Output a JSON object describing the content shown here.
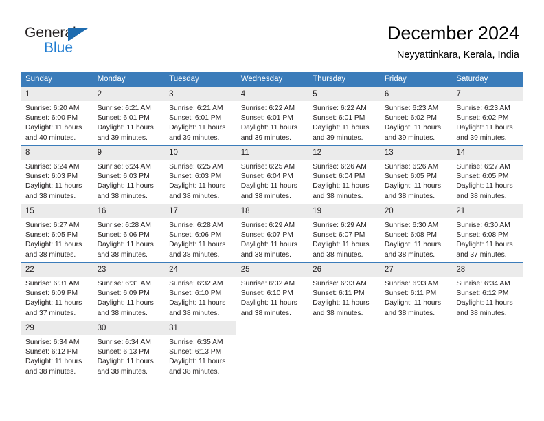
{
  "brand": {
    "name_top": "General",
    "name_bottom": "Blue"
  },
  "header": {
    "title": "December 2024",
    "subtitle": "Neyyattinkara, Kerala, India"
  },
  "colors": {
    "header_blue": "#3b7cba",
    "logo_blue": "#1e7bd0",
    "daynum_gray": "#ebebeb",
    "text": "#231f20"
  },
  "weekdays": [
    "Sunday",
    "Monday",
    "Tuesday",
    "Wednesday",
    "Thursday",
    "Friday",
    "Saturday"
  ],
  "weeks": [
    [
      {
        "day": "1",
        "sunrise": "Sunrise: 6:20 AM",
        "sunset": "Sunset: 6:00 PM",
        "daylight1": "Daylight: 11 hours",
        "daylight2": "and 40 minutes."
      },
      {
        "day": "2",
        "sunrise": "Sunrise: 6:21 AM",
        "sunset": "Sunset: 6:01 PM",
        "daylight1": "Daylight: 11 hours",
        "daylight2": "and 39 minutes."
      },
      {
        "day": "3",
        "sunrise": "Sunrise: 6:21 AM",
        "sunset": "Sunset: 6:01 PM",
        "daylight1": "Daylight: 11 hours",
        "daylight2": "and 39 minutes."
      },
      {
        "day": "4",
        "sunrise": "Sunrise: 6:22 AM",
        "sunset": "Sunset: 6:01 PM",
        "daylight1": "Daylight: 11 hours",
        "daylight2": "and 39 minutes."
      },
      {
        "day": "5",
        "sunrise": "Sunrise: 6:22 AM",
        "sunset": "Sunset: 6:01 PM",
        "daylight1": "Daylight: 11 hours",
        "daylight2": "and 39 minutes."
      },
      {
        "day": "6",
        "sunrise": "Sunrise: 6:23 AM",
        "sunset": "Sunset: 6:02 PM",
        "daylight1": "Daylight: 11 hours",
        "daylight2": "and 39 minutes."
      },
      {
        "day": "7",
        "sunrise": "Sunrise: 6:23 AM",
        "sunset": "Sunset: 6:02 PM",
        "daylight1": "Daylight: 11 hours",
        "daylight2": "and 39 minutes."
      }
    ],
    [
      {
        "day": "8",
        "sunrise": "Sunrise: 6:24 AM",
        "sunset": "Sunset: 6:03 PM",
        "daylight1": "Daylight: 11 hours",
        "daylight2": "and 38 minutes."
      },
      {
        "day": "9",
        "sunrise": "Sunrise: 6:24 AM",
        "sunset": "Sunset: 6:03 PM",
        "daylight1": "Daylight: 11 hours",
        "daylight2": "and 38 minutes."
      },
      {
        "day": "10",
        "sunrise": "Sunrise: 6:25 AM",
        "sunset": "Sunset: 6:03 PM",
        "daylight1": "Daylight: 11 hours",
        "daylight2": "and 38 minutes."
      },
      {
        "day": "11",
        "sunrise": "Sunrise: 6:25 AM",
        "sunset": "Sunset: 6:04 PM",
        "daylight1": "Daylight: 11 hours",
        "daylight2": "and 38 minutes."
      },
      {
        "day": "12",
        "sunrise": "Sunrise: 6:26 AM",
        "sunset": "Sunset: 6:04 PM",
        "daylight1": "Daylight: 11 hours",
        "daylight2": "and 38 minutes."
      },
      {
        "day": "13",
        "sunrise": "Sunrise: 6:26 AM",
        "sunset": "Sunset: 6:05 PM",
        "daylight1": "Daylight: 11 hours",
        "daylight2": "and 38 minutes."
      },
      {
        "day": "14",
        "sunrise": "Sunrise: 6:27 AM",
        "sunset": "Sunset: 6:05 PM",
        "daylight1": "Daylight: 11 hours",
        "daylight2": "and 38 minutes."
      }
    ],
    [
      {
        "day": "15",
        "sunrise": "Sunrise: 6:27 AM",
        "sunset": "Sunset: 6:05 PM",
        "daylight1": "Daylight: 11 hours",
        "daylight2": "and 38 minutes."
      },
      {
        "day": "16",
        "sunrise": "Sunrise: 6:28 AM",
        "sunset": "Sunset: 6:06 PM",
        "daylight1": "Daylight: 11 hours",
        "daylight2": "and 38 minutes."
      },
      {
        "day": "17",
        "sunrise": "Sunrise: 6:28 AM",
        "sunset": "Sunset: 6:06 PM",
        "daylight1": "Daylight: 11 hours",
        "daylight2": "and 38 minutes."
      },
      {
        "day": "18",
        "sunrise": "Sunrise: 6:29 AM",
        "sunset": "Sunset: 6:07 PM",
        "daylight1": "Daylight: 11 hours",
        "daylight2": "and 38 minutes."
      },
      {
        "day": "19",
        "sunrise": "Sunrise: 6:29 AM",
        "sunset": "Sunset: 6:07 PM",
        "daylight1": "Daylight: 11 hours",
        "daylight2": "and 38 minutes."
      },
      {
        "day": "20",
        "sunrise": "Sunrise: 6:30 AM",
        "sunset": "Sunset: 6:08 PM",
        "daylight1": "Daylight: 11 hours",
        "daylight2": "and 38 minutes."
      },
      {
        "day": "21",
        "sunrise": "Sunrise: 6:30 AM",
        "sunset": "Sunset: 6:08 PM",
        "daylight1": "Daylight: 11 hours",
        "daylight2": "and 37 minutes."
      }
    ],
    [
      {
        "day": "22",
        "sunrise": "Sunrise: 6:31 AM",
        "sunset": "Sunset: 6:09 PM",
        "daylight1": "Daylight: 11 hours",
        "daylight2": "and 37 minutes."
      },
      {
        "day": "23",
        "sunrise": "Sunrise: 6:31 AM",
        "sunset": "Sunset: 6:09 PM",
        "daylight1": "Daylight: 11 hours",
        "daylight2": "and 38 minutes."
      },
      {
        "day": "24",
        "sunrise": "Sunrise: 6:32 AM",
        "sunset": "Sunset: 6:10 PM",
        "daylight1": "Daylight: 11 hours",
        "daylight2": "and 38 minutes."
      },
      {
        "day": "25",
        "sunrise": "Sunrise: 6:32 AM",
        "sunset": "Sunset: 6:10 PM",
        "daylight1": "Daylight: 11 hours",
        "daylight2": "and 38 minutes."
      },
      {
        "day": "26",
        "sunrise": "Sunrise: 6:33 AM",
        "sunset": "Sunset: 6:11 PM",
        "daylight1": "Daylight: 11 hours",
        "daylight2": "and 38 minutes."
      },
      {
        "day": "27",
        "sunrise": "Sunrise: 6:33 AM",
        "sunset": "Sunset: 6:11 PM",
        "daylight1": "Daylight: 11 hours",
        "daylight2": "and 38 minutes."
      },
      {
        "day": "28",
        "sunrise": "Sunrise: 6:34 AM",
        "sunset": "Sunset: 6:12 PM",
        "daylight1": "Daylight: 11 hours",
        "daylight2": "and 38 minutes."
      }
    ],
    [
      {
        "day": "29",
        "sunrise": "Sunrise: 6:34 AM",
        "sunset": "Sunset: 6:12 PM",
        "daylight1": "Daylight: 11 hours",
        "daylight2": "and 38 minutes."
      },
      {
        "day": "30",
        "sunrise": "Sunrise: 6:34 AM",
        "sunset": "Sunset: 6:13 PM",
        "daylight1": "Daylight: 11 hours",
        "daylight2": "and 38 minutes."
      },
      {
        "day": "31",
        "sunrise": "Sunrise: 6:35 AM",
        "sunset": "Sunset: 6:13 PM",
        "daylight1": "Daylight: 11 hours",
        "daylight2": "and 38 minutes."
      },
      {
        "day": "",
        "sunrise": "",
        "sunset": "",
        "daylight1": "",
        "daylight2": ""
      },
      {
        "day": "",
        "sunrise": "",
        "sunset": "",
        "daylight1": "",
        "daylight2": ""
      },
      {
        "day": "",
        "sunrise": "",
        "sunset": "",
        "daylight1": "",
        "daylight2": ""
      },
      {
        "day": "",
        "sunrise": "",
        "sunset": "",
        "daylight1": "",
        "daylight2": ""
      }
    ]
  ]
}
